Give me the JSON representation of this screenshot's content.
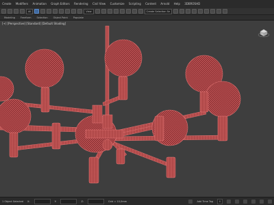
{
  "menu": [
    "Create",
    "Modifiers",
    "Animation",
    "Graph Editors",
    "Rendering",
    "Civil View",
    "Customize",
    "Scripting",
    "Content",
    "Arnold",
    "Help",
    "3DBROSHD"
  ],
  "toolbar": {
    "selection_filter": "All",
    "view_dropdown": "View",
    "named_selection": "Create Selection Se"
  },
  "ribbon_tabs": [
    "Modeling",
    "Freeform",
    "Selection",
    "Object Paint",
    "Populate"
  ],
  "viewport": {
    "label": "[+] [Perspective] [Standard] [Default Shading]"
  },
  "status": {
    "object_count": "1 Object Selected",
    "x_label": "X:",
    "y_label": "Y:",
    "z_label": "Z:",
    "grid": "Grid = 10,0mm",
    "add_time_tag": "Add Time Tag",
    "auto_key": "Auto Key",
    "selected": "Selected",
    "frame": "0"
  },
  "colors": {
    "accent": "#3f6aa0",
    "model_fill": "#9a3a3c",
    "model_wire": "#e06a6a"
  }
}
